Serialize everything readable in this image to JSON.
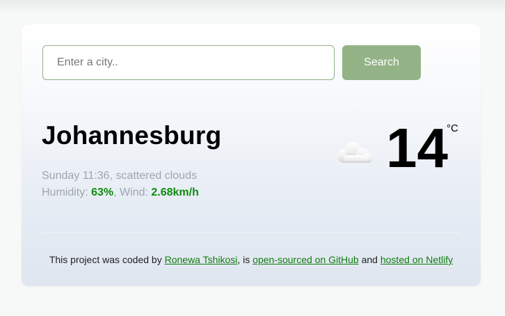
{
  "search": {
    "placeholder": "Enter a city..",
    "button_label": "Search"
  },
  "weather": {
    "city": "Johannesburg",
    "day_time": "Sunday 11:36",
    "separator": ", ",
    "description": "scattered clouds",
    "humidity_label": "Humidity: ",
    "humidity_value": "63%",
    "wind_label": ", Wind: ",
    "wind_value": "2.68km/h",
    "temperature": "14",
    "unit": "°C",
    "icon": "cloud-icon"
  },
  "footer": {
    "prefix": "This project was coded by ",
    "author_link": "Ronewa Tshikosi",
    "middle": ", is ",
    "github_link": "open-sourced on GitHub",
    "and_text": " and ",
    "netlify_link": "hosted on Netlify"
  },
  "colors": {
    "accent_green": "#93b386",
    "value_green": "#108a10",
    "link_green": "#0f7b0f"
  }
}
